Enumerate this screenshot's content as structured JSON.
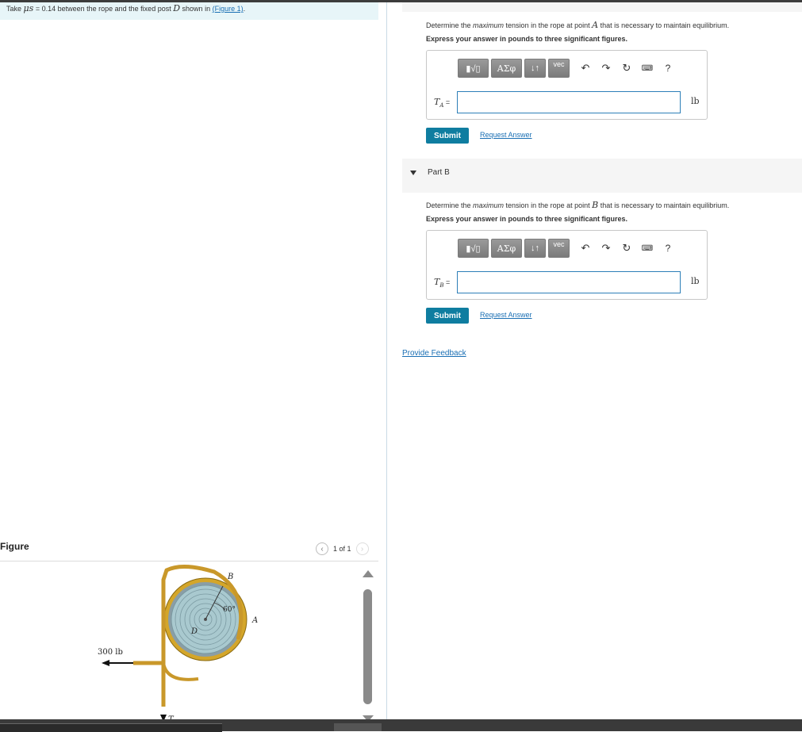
{
  "problem": {
    "prefix": "Take",
    "mu_symbol": "μs",
    "text": " = 0.14 between the rope and the fixed post ",
    "post_symbol": "D",
    "text2": " shown in ",
    "figure_link": "(Figure 1)",
    "suffix": "."
  },
  "figure": {
    "title": "Figure",
    "pager": "1 of 1",
    "labels": {
      "B": "B",
      "A": "A",
      "D": "D",
      "angle": "60°",
      "load": "300 lb",
      "T": "T"
    }
  },
  "part_a": {
    "q_pre": "Determine the ",
    "q_em": "maximum",
    "q_mid": " tension in the rope at point ",
    "q_var": "A",
    "q_post": " that is necessary to maintain equilibrium.",
    "instruction": "Express your answer in pounds to three significant figures.",
    "label_var": "T",
    "label_sub": "A",
    "label_eq": " =",
    "unit": "lb",
    "submit": "Submit",
    "request": "Request Answer"
  },
  "part_b": {
    "header": "Part B",
    "q_pre": "Determine the ",
    "q_em": "maximum",
    "q_mid": " tension in the rope at point ",
    "q_var": "B",
    "q_post": " that is necessary to maintain equilibrium.",
    "instruction": "Express your answer in pounds to three significant figures.",
    "label_var": "T",
    "label_sub": "B",
    "label_eq": " =",
    "unit": "lb",
    "submit": "Submit",
    "request": "Request Answer"
  },
  "toolbar": {
    "templates": "▮√▯",
    "greek": "ΑΣφ",
    "arrows": "↓↑",
    "vec": "vec",
    "undo": "↶",
    "redo": "↷",
    "reset": "↻",
    "keyboard": "⌨",
    "help": "?"
  },
  "feedback": "Provide Feedback"
}
